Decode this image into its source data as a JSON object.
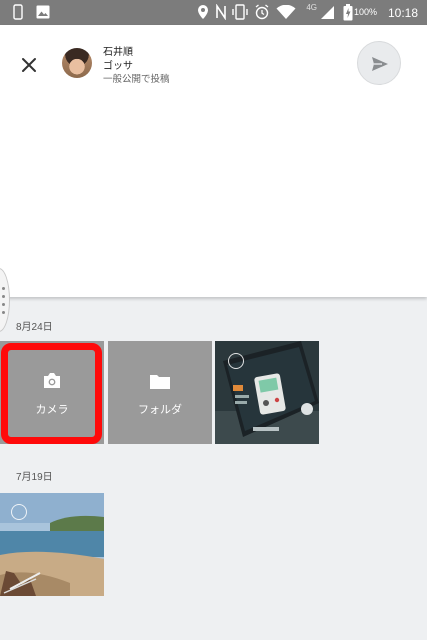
{
  "status_bar": {
    "time": "10:18",
    "battery_percent": "100%",
    "network": "4G",
    "icons": [
      "phone-outline-icon",
      "image-icon",
      "location-icon",
      "nfc-icon",
      "vibrate-icon",
      "alarm-icon",
      "wifi-icon",
      "signal-icon",
      "battery-icon"
    ]
  },
  "compose": {
    "user_name": "石井順",
    "community": "ゴッサ",
    "visibility": "一般公開で投稿",
    "close_icon": "close-icon",
    "send_icon": "send-icon"
  },
  "gallery": {
    "groups": [
      {
        "date": "8月24日",
        "tiles": [
          {
            "type": "camera",
            "label": "カメラ",
            "icon": "camera-icon"
          },
          {
            "type": "folder",
            "label": "フォルダ",
            "icon": "folder-icon"
          },
          {
            "type": "photo",
            "label": ""
          }
        ]
      },
      {
        "date": "7月19日",
        "tiles": [
          {
            "type": "photo",
            "label": ""
          }
        ]
      }
    ]
  },
  "colors": {
    "highlight": "#ff0a0a",
    "tile_background": "#9a9a9a",
    "page_background": "#eef0f2"
  }
}
